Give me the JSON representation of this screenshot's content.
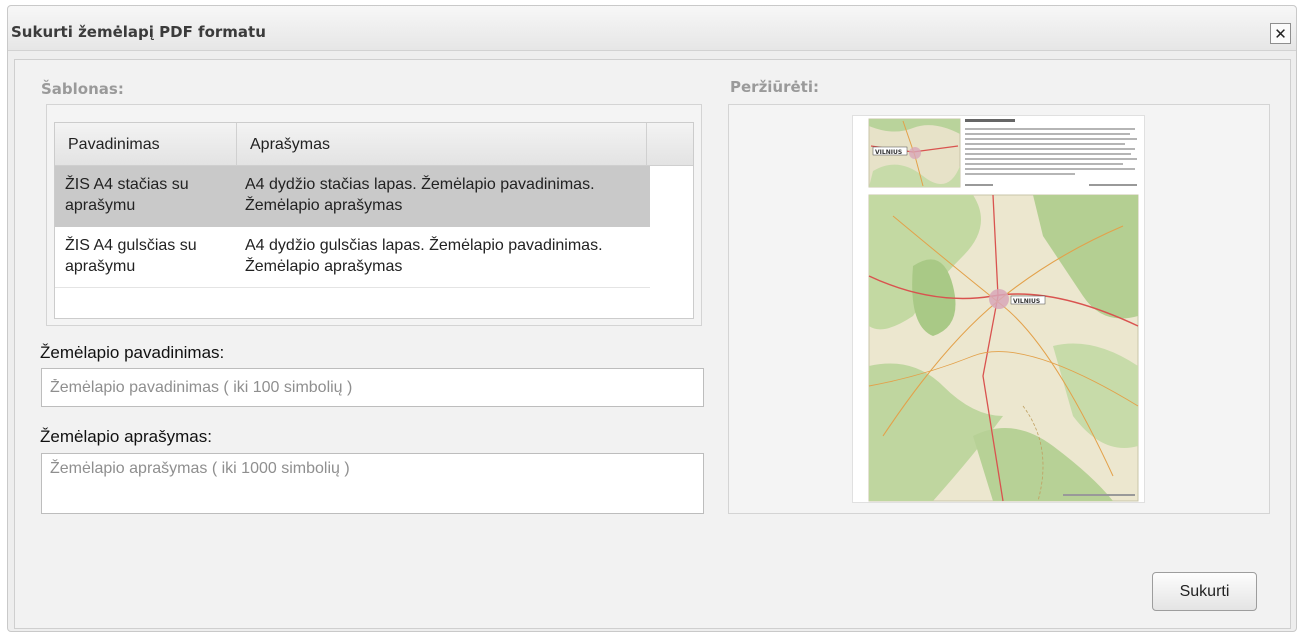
{
  "dialog": {
    "title": "Sukurti žemėlapį PDF formatu",
    "close_symbol": "✕"
  },
  "template_section": {
    "heading": "Šablonas:",
    "columns": [
      "Pavadinimas",
      "Aprašymas"
    ],
    "rows": [
      {
        "name": "ŽIS A4 stačias su aprašymu",
        "description": "A4 dydžio stačias lapas. Žemėlapio pavadinimas. Žemėlapio aprašymas",
        "selected": true
      },
      {
        "name": "ŽIS A4 gulsčias su aprašymu",
        "description": "A4 dydžio gulsčias lapas. Žemėlapio pavadinimas. Žemėlapio aprašymas",
        "selected": false
      }
    ]
  },
  "map_title": {
    "label": "Žemėlapio pavadinimas:",
    "placeholder": "Žemėlapio pavadinimas ( iki 100 simbolių )",
    "value": ""
  },
  "map_description": {
    "label": "Žemėlapio aprašymas:",
    "placeholder": "Žemėlapio aprašymas ( iki 1000 simbolių )",
    "value": ""
  },
  "preview": {
    "heading": "Peržiūrėti:",
    "inset_city_label": "VILNIUS",
    "main_city_label": "VILNIUS"
  },
  "actions": {
    "create_label": "Sukurti"
  },
  "colors": {
    "selected_row": "#c9c9c9",
    "heading_gray": "#9a9a9a",
    "map_green": "#b9d39b",
    "map_land": "#ece7cf",
    "road_red": "#d9534f",
    "road_orange": "#e3a14a"
  }
}
